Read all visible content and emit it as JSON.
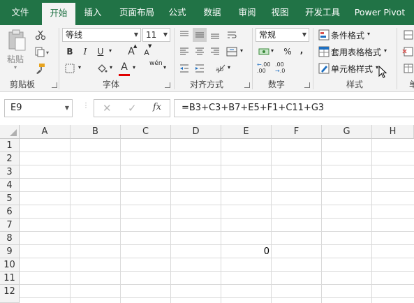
{
  "tabs": [
    "文件",
    "开始",
    "插入",
    "页面布局",
    "公式",
    "数据",
    "审阅",
    "视图",
    "开发工具",
    "Power Pivot"
  ],
  "active_tab": "开始",
  "clipboard": {
    "paste_label": "粘贴",
    "group_label": "剪贴板"
  },
  "font": {
    "font_name": "等线",
    "font_size": "11",
    "group_label": "字体",
    "bold": "B",
    "italic": "I",
    "underline": "U",
    "grow": "A",
    "shrink": "A",
    "color_letter": "A",
    "phonetic": "wén"
  },
  "alignment": {
    "group_label": "对齐方式"
  },
  "number": {
    "format": "常规",
    "group_label": "数字",
    "percent": "%",
    "comma": ",",
    "inc_decimal": ".00",
    "dec_decimal": ".00"
  },
  "styles": {
    "conditional": "条件格式",
    "table": "套用表格格式",
    "cell_styles": "单元格样式",
    "group_label": "样式"
  },
  "cells_group_partial": "单",
  "name_box": "E9",
  "formula": "=B3+C3+B7+E5+F1+C11+G3",
  "fx": "fx",
  "columns": [
    "A",
    "B",
    "C",
    "D",
    "E",
    "F",
    "G",
    "H"
  ],
  "rows": [
    "1",
    "2",
    "3",
    "4",
    "5",
    "6",
    "7",
    "8",
    "9",
    "10",
    "11",
    "12"
  ],
  "cells": {
    "E9": "0"
  },
  "colors": {
    "accent": "#217346",
    "font_color_bar": "#e00000"
  }
}
